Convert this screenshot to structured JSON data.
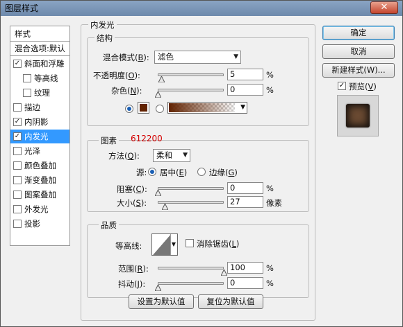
{
  "window": {
    "title": "图层样式",
    "close_glyph": "✕"
  },
  "sidebar": {
    "items": [
      {
        "label": "样式",
        "checkbox": false
      },
      {
        "label": "混合选项:默认",
        "checkbox": false
      },
      {
        "label": "斜面和浮雕",
        "checkbox": true,
        "checked": true
      },
      {
        "label": "等高线",
        "checkbox": true,
        "checked": false
      },
      {
        "label": "纹理",
        "checkbox": true,
        "checked": false
      },
      {
        "label": "描边",
        "checkbox": true,
        "checked": false
      },
      {
        "label": "内阴影",
        "checkbox": true,
        "checked": true
      },
      {
        "label": "内发光",
        "checkbox": true,
        "checked": true,
        "selected": true
      },
      {
        "label": "光泽",
        "checkbox": true,
        "checked": false
      },
      {
        "label": "颜色叠加",
        "checkbox": true,
        "checked": false
      },
      {
        "label": "渐变叠加",
        "checkbox": true,
        "checked": false
      },
      {
        "label": "图案叠加",
        "checkbox": true,
        "checked": false
      },
      {
        "label": "外发光",
        "checkbox": true,
        "checked": false
      },
      {
        "label": "投影",
        "checkbox": true,
        "checked": false
      }
    ]
  },
  "panel": {
    "title": "内发光",
    "structure": {
      "title": "结构",
      "blend_mode": {
        "label": "混合模式",
        "key": "B",
        "value": "滤色"
      },
      "opacity": {
        "label": "不透明度",
        "key": "O",
        "value": "5",
        "unit": "%",
        "level": 0.05
      },
      "noise": {
        "label": "杂色",
        "key": "N",
        "value": "0",
        "unit": "%",
        "level": 0
      },
      "color": "#612200"
    },
    "elements": {
      "title": "图素",
      "annotation": "612200",
      "method": {
        "label": "方法",
        "key": "Q",
        "value": "柔和"
      },
      "source": {
        "label": "源:",
        "center": "居中",
        "center_key": "E",
        "edge": "边缘",
        "edge_key": "G"
      },
      "choke": {
        "label": "阻塞",
        "key": "C",
        "value": "0",
        "unit": "%",
        "level": 0
      },
      "size": {
        "label": "大小",
        "key": "S",
        "value": "27",
        "unit": "像素",
        "level": 0.11
      }
    },
    "quality": {
      "title": "品质",
      "contour": {
        "label": "等高线:"
      },
      "anti_alias": {
        "label": "消除锯齿",
        "key": "L",
        "checked": false
      },
      "range": {
        "label": "范围",
        "key": "R",
        "value": "100",
        "unit": "%",
        "level": 1.0
      },
      "jitter": {
        "label": "抖动",
        "key": "J",
        "value": "0",
        "unit": "%",
        "level": 0
      }
    },
    "buttons": {
      "set_default": "设置为默认值",
      "reset_default": "复位为默认值"
    }
  },
  "actions": {
    "ok": "确定",
    "cancel": "取消",
    "new_style": "新建样式(W)...",
    "preview": {
      "label": "预览",
      "key": "V",
      "checked": true
    }
  },
  "colors": {
    "annotation": "#d40000",
    "selection": "#3399ff",
    "glow": "#612200"
  }
}
